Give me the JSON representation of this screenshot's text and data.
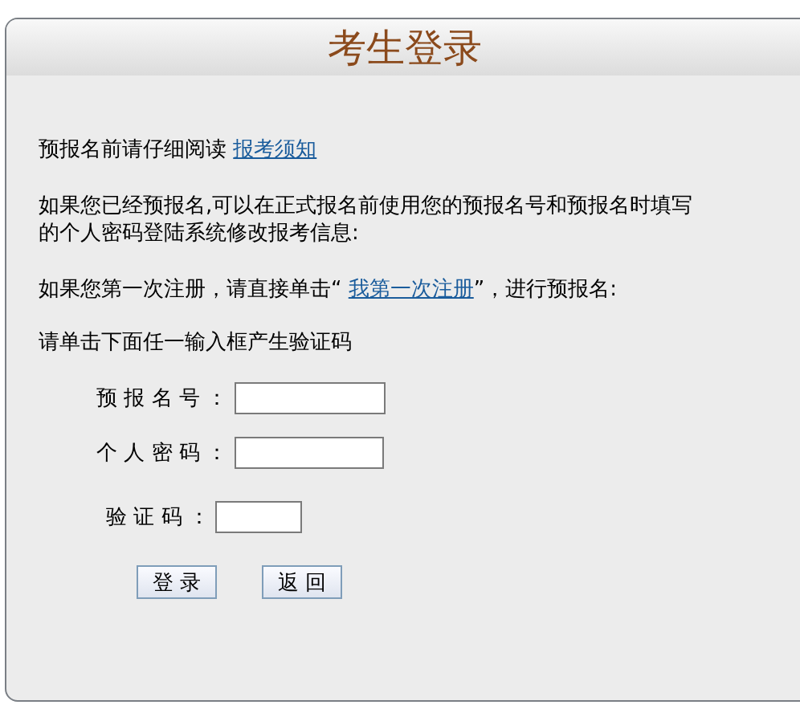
{
  "title": "考生登录",
  "paragraphs": [
    {
      "before": "预报名前请仔细阅读 ",
      "link": "报考须知"
    },
    {
      "before": "如果您已经预报名,可以在正式报名前使用您的预报名号和预报名时填写的个人密码登陆系统修改报考信息:"
    },
    {
      "before": "如果您第一次注册，请直接单击“ ",
      "link": "我第一次注册",
      "after": "”，进行预报名:"
    },
    {
      "before": "请单击下面任一输入框产生验证码"
    }
  ],
  "fields": [
    {
      "label": "预 报 名 号 ："
    },
    {
      "label": "个 人 密 码 ："
    },
    {
      "label": "验 证 码 ："
    }
  ],
  "buttons": [
    "登 录",
    "返 回"
  ]
}
